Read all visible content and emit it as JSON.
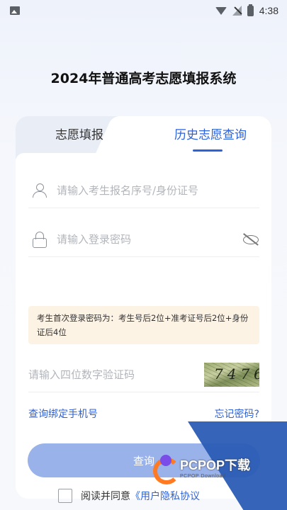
{
  "status_bar": {
    "time": "4:38"
  },
  "page": {
    "title": "2024年普通高考志愿填报系统"
  },
  "tabs": {
    "fill": "志愿填报",
    "history": "历史志愿查询"
  },
  "form": {
    "id_placeholder": "请输入考生报名序号/身份证号",
    "password_placeholder": "请输入登录密码",
    "hint": "考生首次登录密码为：考生号后2位+准考证号后2位+身份证后4位",
    "captcha_placeholder": "请输入四位数字验证码",
    "captcha_code": "7476"
  },
  "links": {
    "bind_phone": "查询绑定手机号",
    "forgot_password": "忘记密码?"
  },
  "submit": {
    "label": "查询"
  },
  "agreement": {
    "prefix": "阅读并同意",
    "link": "《用户隐私协议"
  },
  "watermark": {
    "brand": "PCPOP下载",
    "sub": "PCPOP Download"
  },
  "colors": {
    "accent": "#2e62d8",
    "button": "#99b2ea",
    "hint_bg": "#fdf3e5"
  }
}
